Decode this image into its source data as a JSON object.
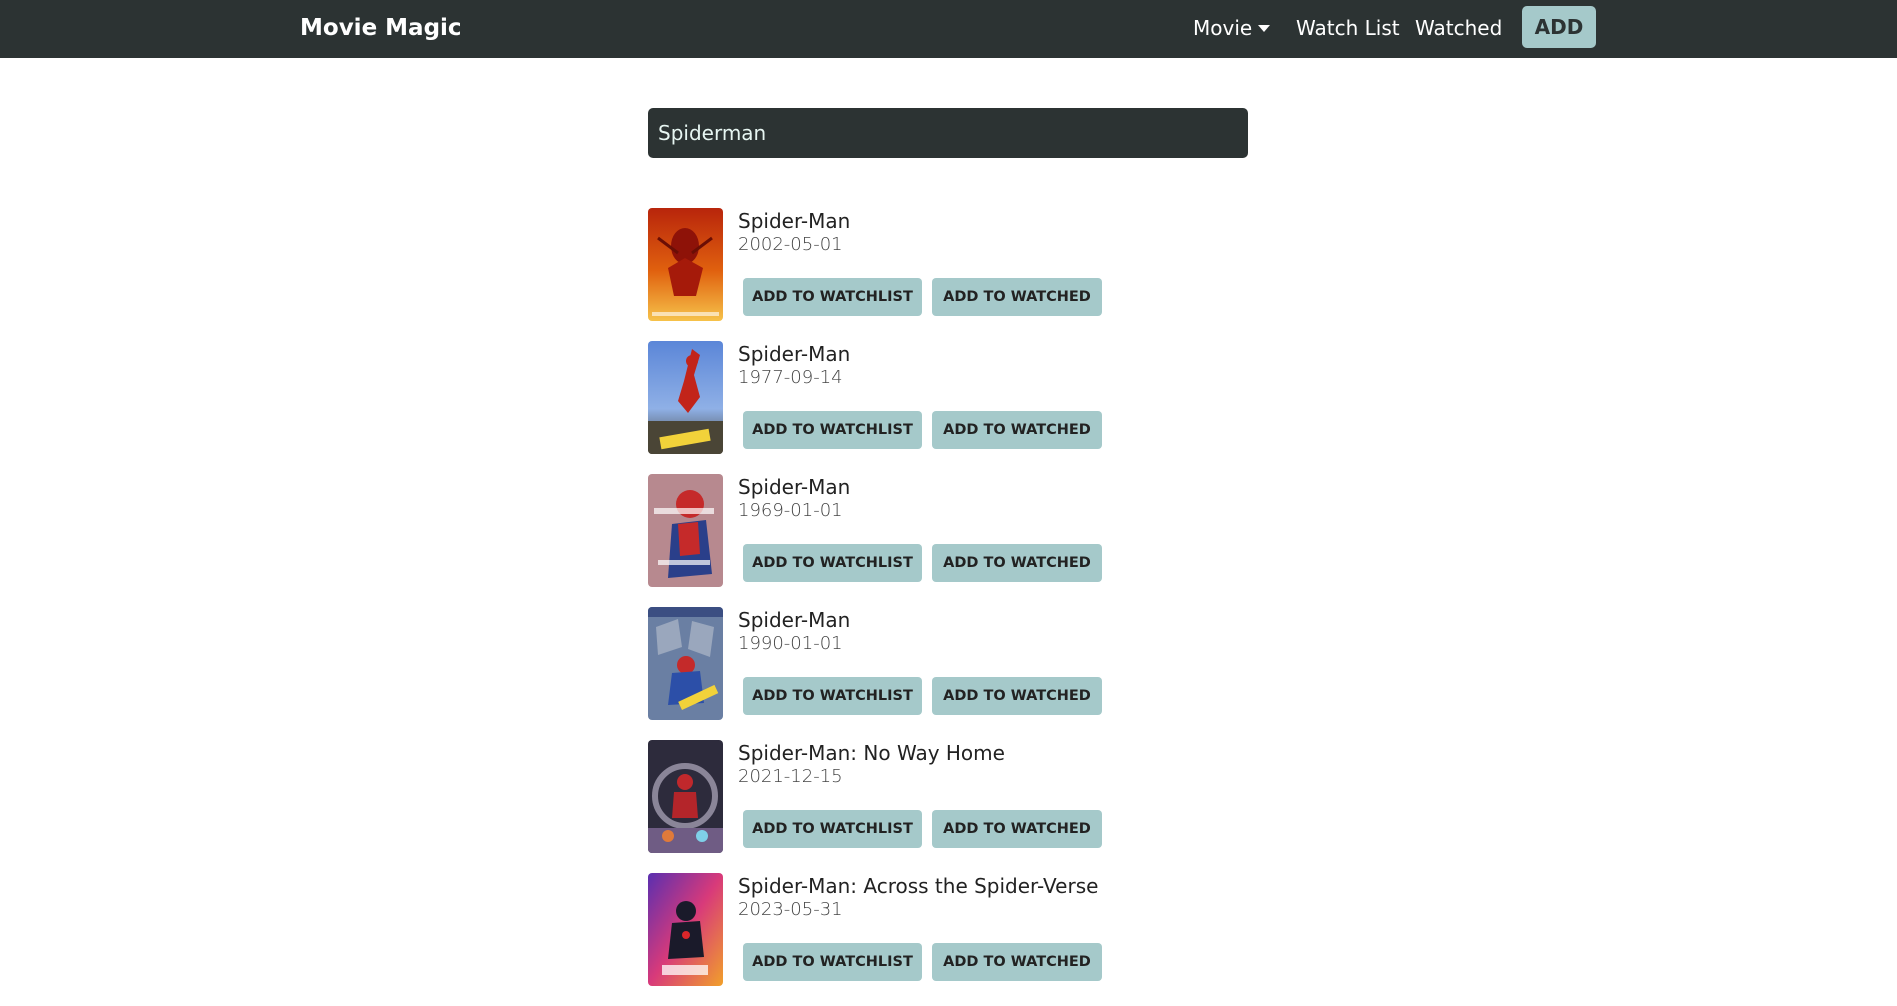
{
  "navbar": {
    "brand": "Movie Magic",
    "movie_label": "Movie",
    "watchlist_label": "Watch List",
    "watched_label": "Watched",
    "add_label": "ADD"
  },
  "search": {
    "value": "Spiderman"
  },
  "buttons": {
    "watchlist": "ADD TO WATCHLIST",
    "watched": "ADD TO WATCHED"
  },
  "results": [
    {
      "title": "Spider-Man",
      "date": "2002-05-01"
    },
    {
      "title": "Spider-Man",
      "date": "1977-09-14"
    },
    {
      "title": "Spider-Man",
      "date": "1969-01-01"
    },
    {
      "title": "Spider-Man",
      "date": "1990-01-01"
    },
    {
      "title": "Spider-Man: No Way Home",
      "date": "2021-12-15"
    },
    {
      "title": "Spider-Man: Across the Spider-Verse",
      "date": "2023-05-31"
    }
  ],
  "colors": {
    "navbar_bg": "#2c3333",
    "accent": "#a5c9ca"
  }
}
